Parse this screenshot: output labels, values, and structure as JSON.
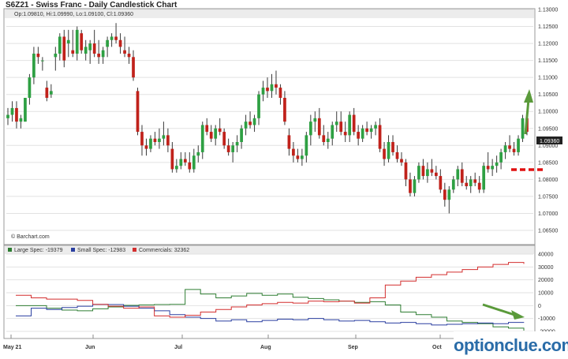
{
  "header": {
    "title": "S6Z21 - Swiss Franc - Daily Candlestick Chart",
    "ohlc": "Op:1.09810, Hi:1.09990, Lo:1.09100, Cl:1.09360"
  },
  "credit": "© Barchart.com",
  "watermark": "optionclue.com",
  "chart_data": [
    {
      "type": "candlestick",
      "title": "S6Z21 - Swiss Franc - Daily Candlestick Chart",
      "ylim": [
        1.065,
        1.13
      ],
      "yticks": [
        "1.13000",
        "1.12500",
        "1.12000",
        "1.11500",
        "1.11000",
        "1.10500",
        "1.10000",
        "1.09500",
        "1.09000",
        "1.08500",
        "1.08000",
        "1.07500",
        "1.07000",
        "1.06500"
      ],
      "last_price_label": "1.09360",
      "colors": {
        "up": "#2ea043",
        "down": "#c0221b",
        "neutral": "#444444",
        "arrow": "#5a9a3a",
        "level": "#e01010"
      },
      "candles": [
        [
          1.098,
          1.101,
          1.096,
          1.099
        ],
        [
          1.099,
          1.103,
          1.097,
          1.101
        ],
        [
          1.101,
          1.103,
          1.095,
          1.097
        ],
        [
          1.097,
          1.099,
          1.095,
          1.098
        ],
        [
          1.097,
          1.104,
          1.097,
          1.104
        ],
        [
          1.104,
          1.111,
          1.102,
          1.11
        ],
        [
          1.11,
          1.119,
          1.108,
          1.117
        ],
        [
          1.117,
          1.119,
          1.114,
          1.116
        ],
        [
          1.115,
          1.116,
          1.112,
          1.115
        ],
        [
          1.107,
          1.109,
          1.103,
          1.104
        ],
        [
          1.105,
          1.108,
          1.104,
          1.106
        ],
        [
          1.116,
          1.119,
          1.112,
          1.117
        ],
        [
          1.117,
          1.123,
          1.115,
          1.122
        ],
        [
          1.122,
          1.124,
          1.113,
          1.115
        ],
        [
          1.12,
          1.124,
          1.116,
          1.121
        ],
        [
          1.118,
          1.124,
          1.116,
          1.117
        ],
        [
          1.117,
          1.125,
          1.115,
          1.124
        ],
        [
          1.123,
          1.124,
          1.117,
          1.118
        ],
        [
          1.117,
          1.121,
          1.115,
          1.119
        ],
        [
          1.118,
          1.121,
          1.114,
          1.12
        ],
        [
          1.12,
          1.124,
          1.116,
          1.117
        ],
        [
          1.117,
          1.121,
          1.114,
          1.116
        ],
        [
          1.116,
          1.119,
          1.114,
          1.118
        ],
        [
          1.119,
          1.122,
          1.116,
          1.121
        ],
        [
          1.121,
          1.123,
          1.119,
          1.122
        ],
        [
          1.122,
          1.126,
          1.12,
          1.121
        ],
        [
          1.121,
          1.123,
          1.117,
          1.119
        ],
        [
          1.118,
          1.122,
          1.116,
          1.117
        ],
        [
          1.117,
          1.119,
          1.114,
          1.116
        ],
        [
          1.116,
          1.118,
          1.109,
          1.11
        ],
        [
          1.106,
          1.107,
          1.093,
          1.094
        ],
        [
          1.094,
          1.096,
          1.087,
          1.09
        ],
        [
          1.09,
          1.092,
          1.087,
          1.089
        ],
        [
          1.089,
          1.093,
          1.088,
          1.092
        ],
        [
          1.092,
          1.094,
          1.09,
          1.091
        ],
        [
          1.091,
          1.095,
          1.089,
          1.092
        ],
        [
          1.092,
          1.097,
          1.09,
          1.093
        ],
        [
          1.093,
          1.095,
          1.088,
          1.09
        ],
        [
          1.089,
          1.091,
          1.082,
          1.083
        ],
        [
          1.083,
          1.086,
          1.082,
          1.084
        ],
        [
          1.084,
          1.088,
          1.083,
          1.086
        ],
        [
          1.086,
          1.088,
          1.084,
          1.085
        ],
        [
          1.085,
          1.088,
          1.082,
          1.083
        ],
        [
          1.083,
          1.089,
          1.082,
          1.087
        ],
        [
          1.087,
          1.09,
          1.085,
          1.088
        ],
        [
          1.088,
          1.097,
          1.086,
          1.096
        ],
        [
          1.096,
          1.098,
          1.093,
          1.094
        ],
        [
          1.094,
          1.096,
          1.091,
          1.092
        ],
        [
          1.092,
          1.096,
          1.09,
          1.095
        ],
        [
          1.095,
          1.098,
          1.093,
          1.094
        ],
        [
          1.094,
          1.095,
          1.089,
          1.09
        ],
        [
          1.09,
          1.092,
          1.087,
          1.088
        ],
        [
          1.088,
          1.091,
          1.085,
          1.09
        ],
        [
          1.09,
          1.093,
          1.088,
          1.091
        ],
        [
          1.091,
          1.096,
          1.089,
          1.095
        ],
        [
          1.095,
          1.099,
          1.093,
          1.097
        ],
        [
          1.097,
          1.1,
          1.095,
          1.096
        ],
        [
          1.096,
          1.099,
          1.094,
          1.098
        ],
        [
          1.098,
          1.106,
          1.096,
          1.105
        ],
        [
          1.105,
          1.109,
          1.103,
          1.107
        ],
        [
          1.107,
          1.11,
          1.104,
          1.106
        ],
        [
          1.106,
          1.111,
          1.104,
          1.108
        ],
        [
          1.108,
          1.112,
          1.105,
          1.107
        ],
        [
          1.107,
          1.108,
          1.102,
          1.104
        ],
        [
          1.104,
          1.106,
          1.096,
          1.097
        ],
        [
          1.093,
          1.095,
          1.087,
          1.089
        ],
        [
          1.089,
          1.091,
          1.085,
          1.087
        ],
        [
          1.087,
          1.089,
          1.085,
          1.086
        ],
        [
          1.086,
          1.089,
          1.084,
          1.087
        ],
        [
          1.087,
          1.094,
          1.085,
          1.093
        ],
        [
          1.093,
          1.099,
          1.09,
          1.097
        ],
        [
          1.097,
          1.1,
          1.094,
          1.098
        ],
        [
          1.098,
          1.101,
          1.092,
          1.093
        ],
        [
          1.093,
          1.096,
          1.09,
          1.091
        ],
        [
          1.091,
          1.094,
          1.089,
          1.092
        ],
        [
          1.092,
          1.097,
          1.09,
          1.096
        ],
        [
          1.096,
          1.1,
          1.094,
          1.097
        ],
        [
          1.097,
          1.1,
          1.093,
          1.094
        ],
        [
          1.094,
          1.097,
          1.091,
          1.093
        ],
        [
          1.093,
          1.1,
          1.091,
          1.099
        ],
        [
          1.099,
          1.101,
          1.093,
          1.094
        ],
        [
          1.094,
          1.096,
          1.09,
          1.092
        ],
        [
          1.092,
          1.096,
          1.091,
          1.095
        ],
        [
          1.095,
          1.097,
          1.093,
          1.094
        ],
        [
          1.094,
          1.096,
          1.092,
          1.095
        ],
        [
          1.095,
          1.097,
          1.093,
          1.096
        ],
        [
          1.096,
          1.098,
          1.088,
          1.089
        ],
        [
          1.089,
          1.091,
          1.084,
          1.086
        ],
        [
          1.086,
          1.093,
          1.085,
          1.091
        ],
        [
          1.091,
          1.093,
          1.087,
          1.088
        ],
        [
          1.088,
          1.09,
          1.085,
          1.086
        ],
        [
          1.086,
          1.088,
          1.084,
          1.085
        ],
        [
          1.085,
          1.086,
          1.078,
          1.08
        ],
        [
          1.08,
          1.082,
          1.075,
          1.076
        ],
        [
          1.076,
          1.081,
          1.075,
          1.08
        ],
        [
          1.08,
          1.085,
          1.079,
          1.084
        ],
        [
          1.084,
          1.086,
          1.08,
          1.081
        ],
        [
          1.081,
          1.085,
          1.079,
          1.083
        ],
        [
          1.083,
          1.086,
          1.081,
          1.082
        ],
        [
          1.082,
          1.084,
          1.08,
          1.081
        ],
        [
          1.081,
          1.083,
          1.076,
          1.077
        ],
        [
          1.077,
          1.079,
          1.072,
          1.074
        ],
        [
          1.074,
          1.078,
          1.07,
          1.077
        ],
        [
          1.077,
          1.081,
          1.076,
          1.08
        ],
        [
          1.08,
          1.084,
          1.078,
          1.083
        ],
        [
          1.083,
          1.085,
          1.078,
          1.079
        ],
        [
          1.079,
          1.081,
          1.077,
          1.078
        ],
        [
          1.078,
          1.081,
          1.076,
          1.08
        ],
        [
          1.08,
          1.082,
          1.078,
          1.079
        ],
        [
          1.079,
          1.081,
          1.076,
          1.077
        ],
        [
          1.077,
          1.085,
          1.076,
          1.084
        ],
        [
          1.084,
          1.088,
          1.082,
          1.083
        ],
        [
          1.083,
          1.086,
          1.081,
          1.084
        ],
        [
          1.084,
          1.087,
          1.082,
          1.085
        ],
        [
          1.085,
          1.089,
          1.083,
          1.088
        ],
        [
          1.088,
          1.091,
          1.086,
          1.09
        ],
        [
          1.09,
          1.093,
          1.088,
          1.089
        ],
        [
          1.089,
          1.091,
          1.087,
          1.088
        ],
        [
          1.088,
          1.093,
          1.087,
          1.092
        ],
        [
          1.092,
          1.099,
          1.091,
          1.098
        ],
        [
          1.098,
          1.1,
          1.093,
          1.094
        ]
      ]
    },
    {
      "type": "line",
      "subtype": "step",
      "ylim": [
        -20000,
        40000
      ],
      "yticks": [
        "40000",
        "30000",
        "20000",
        "10000",
        "0",
        "-10000",
        "-20000"
      ],
      "x": [
        "May 21",
        "Jun",
        "Jul",
        "Aug",
        "Sep",
        "Oct"
      ],
      "series": [
        {
          "name": "Large Spec: -19379",
          "color": "#2e7d32",
          "values": [
            0,
            0,
            -2000,
            -3500,
            -4000,
            -2500,
            -1000,
            200,
            500,
            800,
            1000,
            12500,
            9000,
            6000,
            7500,
            9500,
            8000,
            9000,
            6500,
            5500,
            4500,
            3500,
            2500,
            3000,
            500,
            -5000,
            -7000,
            -9000,
            -12000,
            -13000,
            -14000,
            -16500,
            -17500,
            -19379
          ]
        },
        {
          "name": "Small Spec: -12983",
          "color": "#2a3fa0",
          "values": [
            -8000,
            -2000,
            -3000,
            -1500,
            -500,
            1000,
            800,
            -500,
            -2000,
            -4000,
            -7000,
            -9000,
            -10000,
            -12000,
            -11000,
            -12500,
            -11500,
            -10500,
            -11000,
            -10000,
            -11000,
            -12000,
            -11500,
            -12500,
            -13500,
            -13000,
            -14000,
            -15000,
            -14500,
            -14000,
            -13500,
            -14000,
            -13000,
            -12983
          ]
        },
        {
          "name": "Commercials: 32362",
          "color": "#d32f2f",
          "values": [
            8000,
            6000,
            5000,
            5000,
            4000,
            1000,
            -500,
            -2000,
            -1000,
            -8000,
            -9000,
            -7500,
            -5000,
            -3000,
            -1000,
            500,
            1500,
            2500,
            2000,
            3500,
            3000,
            3500,
            2000,
            6000,
            16000,
            19000,
            22000,
            24000,
            26000,
            28000,
            30000,
            32000,
            33500,
            32362
          ]
        }
      ]
    }
  ]
}
